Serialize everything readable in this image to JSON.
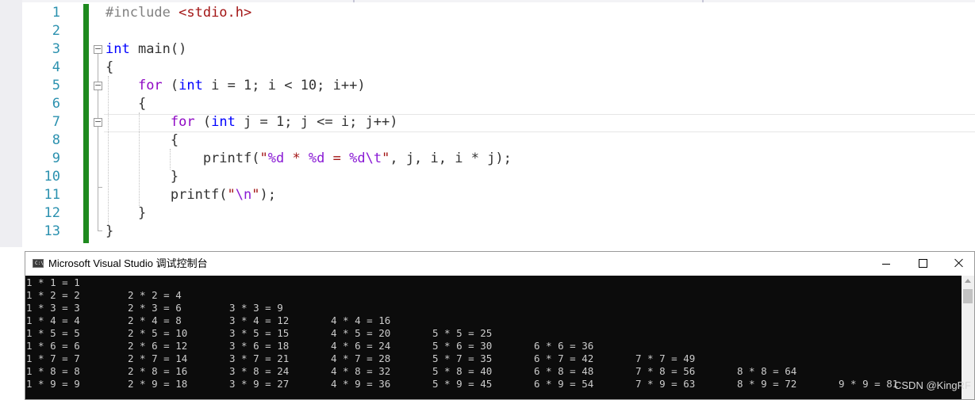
{
  "editor": {
    "line_numbers": [
      "1",
      "2",
      "3",
      "4",
      "5",
      "6",
      "7",
      "8",
      "9",
      "10",
      "11",
      "12",
      "13"
    ],
    "lines": [
      [
        {
          "t": "#include ",
          "c": "pp"
        },
        {
          "t": "<stdio.h>",
          "c": "inc"
        }
      ],
      [],
      [
        {
          "t": "int",
          "c": "kw"
        },
        {
          "t": " main()",
          "c": ""
        }
      ],
      [
        {
          "t": "{",
          "c": ""
        }
      ],
      [
        {
          "t": "    ",
          "c": ""
        },
        {
          "t": "for",
          "c": "ctl"
        },
        {
          "t": " (",
          "c": ""
        },
        {
          "t": "int",
          "c": "kw"
        },
        {
          "t": " i = 1; i < 10; i++)",
          "c": ""
        }
      ],
      [
        {
          "t": "    {",
          "c": ""
        }
      ],
      [
        {
          "t": "        ",
          "c": ""
        },
        {
          "t": "for",
          "c": "ctl"
        },
        {
          "t": " (",
          "c": ""
        },
        {
          "t": "int",
          "c": "kw"
        },
        {
          "t": " j = 1; j <= i; j++)",
          "c": ""
        }
      ],
      [
        {
          "t": "        {",
          "c": ""
        }
      ],
      [
        {
          "t": "            printf(",
          "c": ""
        },
        {
          "t": "\"",
          "c": "str"
        },
        {
          "t": "%d",
          "c": "fmt"
        },
        {
          "t": " * ",
          "c": "str"
        },
        {
          "t": "%d",
          "c": "fmt"
        },
        {
          "t": " = ",
          "c": "str"
        },
        {
          "t": "%d",
          "c": "fmt"
        },
        {
          "t": "\\t",
          "c": "fmt"
        },
        {
          "t": "\"",
          "c": "str"
        },
        {
          "t": ", j, i, i * j);",
          "c": ""
        }
      ],
      [
        {
          "t": "        }",
          "c": ""
        }
      ],
      [
        {
          "t": "        printf(",
          "c": ""
        },
        {
          "t": "\"",
          "c": "str"
        },
        {
          "t": "\\n",
          "c": "fmt"
        },
        {
          "t": "\"",
          "c": "str"
        },
        {
          "t": ");",
          "c": ""
        }
      ],
      [
        {
          "t": "    }",
          "c": ""
        }
      ],
      [
        {
          "t": "}",
          "c": ""
        }
      ]
    ]
  },
  "console": {
    "icon_text": "C:\\",
    "title": "Microsoft Visual Studio 调试控制台",
    "output": [
      [
        "1 * 1 = 1"
      ],
      [
        "1 * 2 = 2",
        "2 * 2 = 4"
      ],
      [
        "1 * 3 = 3",
        "2 * 3 = 6",
        "3 * 3 = 9"
      ],
      [
        "1 * 4 = 4",
        "2 * 4 = 8",
        "3 * 4 = 12",
        "4 * 4 = 16"
      ],
      [
        "1 * 5 = 5",
        "2 * 5 = 10",
        "3 * 5 = 15",
        "4 * 5 = 20",
        "5 * 5 = 25"
      ],
      [
        "1 * 6 = 6",
        "2 * 6 = 12",
        "3 * 6 = 18",
        "4 * 6 = 24",
        "5 * 6 = 30",
        "6 * 6 = 36"
      ],
      [
        "1 * 7 = 7",
        "2 * 7 = 14",
        "3 * 7 = 21",
        "4 * 7 = 28",
        "5 * 7 = 35",
        "6 * 7 = 42",
        "7 * 7 = 49"
      ],
      [
        "1 * 8 = 8",
        "2 * 8 = 16",
        "3 * 8 = 24",
        "4 * 8 = 32",
        "5 * 8 = 40",
        "6 * 8 = 48",
        "7 * 8 = 56",
        "8 * 8 = 64"
      ],
      [
        "1 * 9 = 9",
        "2 * 9 = 18",
        "3 * 9 = 27",
        "4 * 9 = 36",
        "5 * 9 = 45",
        "6 * 9 = 54",
        "7 * 9 = 63",
        "8 * 9 = 72",
        "9 * 9 = 81"
      ]
    ]
  },
  "watermark": "CSDN @KingRF"
}
